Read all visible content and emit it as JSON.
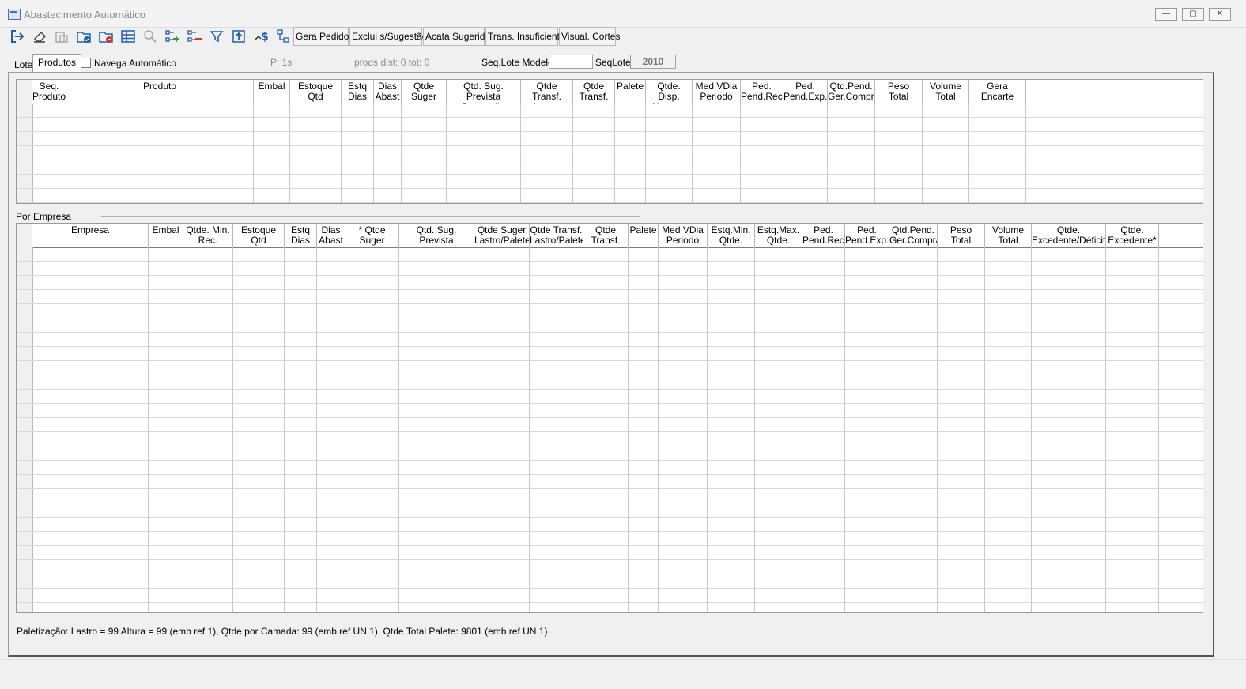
{
  "window": {
    "title": "Abastecimento Automático",
    "minimize": "—",
    "maximize": "▢",
    "close": "✕"
  },
  "toolbar": {
    "icons": [
      "exit-icon",
      "eraser-icon",
      "copy-icon",
      "folder-check-icon",
      "folder-delete-icon",
      "table-icon",
      "search-icon",
      "add-item-icon",
      "remove-item-icon",
      "filter-icon",
      "upload-icon",
      "money-transfer-icon",
      "hierarchy-icon"
    ],
    "buttons": {
      "gera_pedidos": "Gera Pedidos",
      "exclui": "Exclui s/Sugestão",
      "acata": "Acata Sugerido",
      "trans": "Trans. Insuficiente",
      "visual": "Visual. Cortes"
    }
  },
  "tabs": {
    "lote": "Lote",
    "produtos": "Produtos"
  },
  "options": {
    "navega_label": "Navega Automático",
    "p_status": "P: 1s",
    "prods_status": "prods dist: 0  tot: 0",
    "seq_lote_modelo_label": "Seq.Lote Modelo",
    "seq_lote_modelo_value": "",
    "seq_lote_label": "SeqLote",
    "seq_lote_value": "2010"
  },
  "produtos_grid": {
    "columns": [
      "Seq.\nProduto",
      "Produto",
      "Embal",
      "Estoque\nQtd",
      "Estq\nDias",
      "Dias\nAbast",
      "Qtde\nSuger",
      "Qtd. Sug. Prevista\nPromoção",
      "Qtde Transf.\nLastro",
      "Qtde\nTransf.",
      "Palete",
      "Qtde. Disp.\nAbastec.",
      "Med VDia\nPeriodo",
      "Ped.\nPend.Rec.",
      "Ped.\nPend.Exp.",
      "Qtd.Pend.\nGer.Compra",
      "Peso\nTotal",
      "Volume\nTotal",
      "Gera Encarte"
    ],
    "rows": []
  },
  "empresa_section": {
    "label": "Por Empresa"
  },
  "empresa_grid": {
    "columns": [
      "Empresa",
      "Embal",
      "Qtde. Min.\nRec. Transf.",
      "Estoque\nQtd",
      "Estq\nDias",
      "Dias\nAbast",
      "* Qtde\nSuger",
      "Qtd. Sug. Prevista\nPromoção",
      "Qtde Suger\nLastro/Palete",
      "Qtde Transf.\nLastro/Palete",
      "Qtde\nTransf.",
      "Palete",
      "Med VDia\nPeriodo",
      "Estq.Min.\nQtde.",
      "Estq.Max.\nQtde.",
      "Ped.\nPend.Rec.",
      "Ped.\nPend.Exp.",
      "Qtd.Pend.\nGer.Compra",
      "Peso\nTotal",
      "Volume\nTotal",
      "Qtde.\nExcedente/Déficit*",
      "Qtde.\nExcedente*"
    ],
    "rows": []
  },
  "footer": {
    "paletizacao": "Paletização: Lastro = 99 Altura = 99 (emb ref 1), Qtde por Camada: 99 (emb ref UN 1), Qtde Total Palete: 9801 (emb ref UN 1)"
  }
}
